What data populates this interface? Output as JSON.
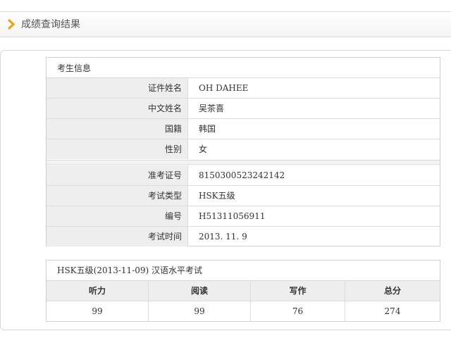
{
  "header": {
    "title": "成绩查询结果",
    "accent_color": "#e8a317"
  },
  "candidate": {
    "section_title": "考生信息",
    "personal": [
      {
        "label": "证件姓名",
        "value": "OH DAHEE"
      },
      {
        "label": "中文姓名",
        "value": "吴茶喜"
      },
      {
        "label": "国籍",
        "value": "韩国"
      },
      {
        "label": "性别",
        "value": "女"
      }
    ],
    "exam": [
      {
        "label": "准考证号",
        "value": "8150300523242142"
      },
      {
        "label": "考试类型",
        "value": "HSK五级"
      },
      {
        "label": "编号",
        "value": "H51311056911"
      },
      {
        "label": "考试时间",
        "value": "2013. 11. 9"
      }
    ]
  },
  "scores": {
    "title": "HSK五级(2013-11-09) 汉语水平考试",
    "headers": [
      "听力",
      "阅读",
      "写作",
      "总分"
    ],
    "values": [
      "99",
      "99",
      "76",
      "274"
    ]
  }
}
